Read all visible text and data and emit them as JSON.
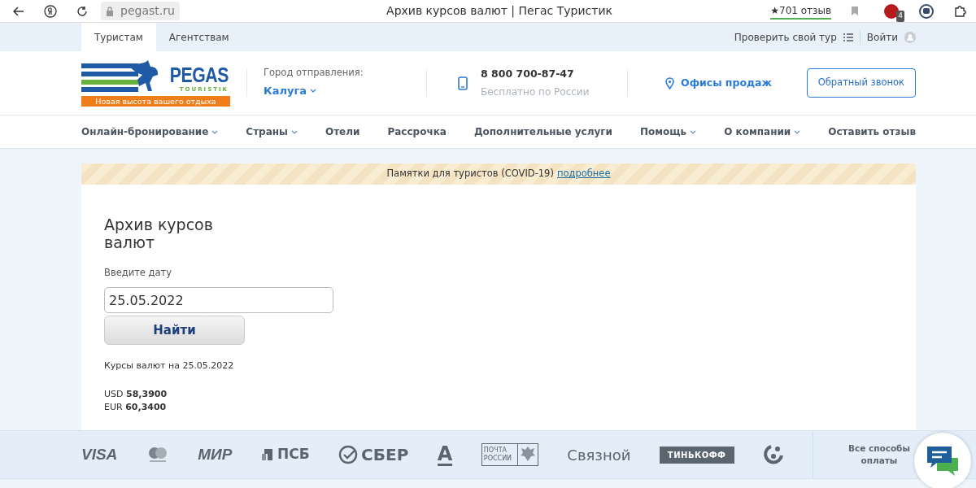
{
  "browser": {
    "url": "pegast.ru",
    "title": "Архив курсов валют | Пегас Туристик",
    "rating": "★701 отзыв",
    "extension_badge": "4"
  },
  "top_tabs": [
    {
      "label": "Туристам",
      "selected": true
    },
    {
      "label": "Агентствам",
      "selected": false
    }
  ],
  "top_links": {
    "check_tour": "Проверить свой тур",
    "login": "Войти"
  },
  "header": {
    "logo": {
      "name": "PEGAS",
      "sub": "TOURISTIK",
      "slogan": "Новая высота вашего отдыха"
    },
    "city_label": "Город отправления:",
    "city": "Калуга",
    "phone": "8 800 700-87-47",
    "phone_note": "Бесплатно по России",
    "offices": "Офисы продаж",
    "callback": "Обратный звонок"
  },
  "nav": [
    {
      "label": "Онлайн-бронирование",
      "dropdown": true
    },
    {
      "label": "Страны",
      "dropdown": true
    },
    {
      "label": "Отели",
      "dropdown": false
    },
    {
      "label": "Рассрочка",
      "dropdown": false
    },
    {
      "label": "Дополнительные услуги",
      "dropdown": false
    },
    {
      "label": "Помощь",
      "dropdown": true
    },
    {
      "label": "О компании",
      "dropdown": true
    },
    {
      "label": "Оставить отзыв",
      "dropdown": false
    }
  ],
  "notice": {
    "text": "Памятки для туристов (COVID-19)",
    "link": "подробнее"
  },
  "archive": {
    "title": "Архив курсов валют",
    "date_label": "Введите дату",
    "date_value": "25.05.2022",
    "button": "Найти",
    "rates_caption": "Курсы валют на 25.05.2022",
    "rates": [
      {
        "code": "USD",
        "value": "58,3900"
      },
      {
        "code": "EUR",
        "value": "60,3400"
      }
    ]
  },
  "payments": [
    {
      "kind": "visa",
      "label": "VISA"
    },
    {
      "kind": "maestro"
    },
    {
      "kind": "mir",
      "label": "МИР"
    },
    {
      "kind": "psb",
      "label": "ПСБ"
    },
    {
      "kind": "sber",
      "label": "СБЕР"
    },
    {
      "kind": "alfa",
      "label": "А"
    },
    {
      "kind": "post",
      "label": "ПОЧТА РОССИИ"
    },
    {
      "kind": "plain",
      "label": "Связной"
    },
    {
      "kind": "tinkoff",
      "label": "ТИНЬКОФФ"
    },
    {
      "kind": "dots"
    }
  ],
  "all_payments": "Все способы оплаты"
}
